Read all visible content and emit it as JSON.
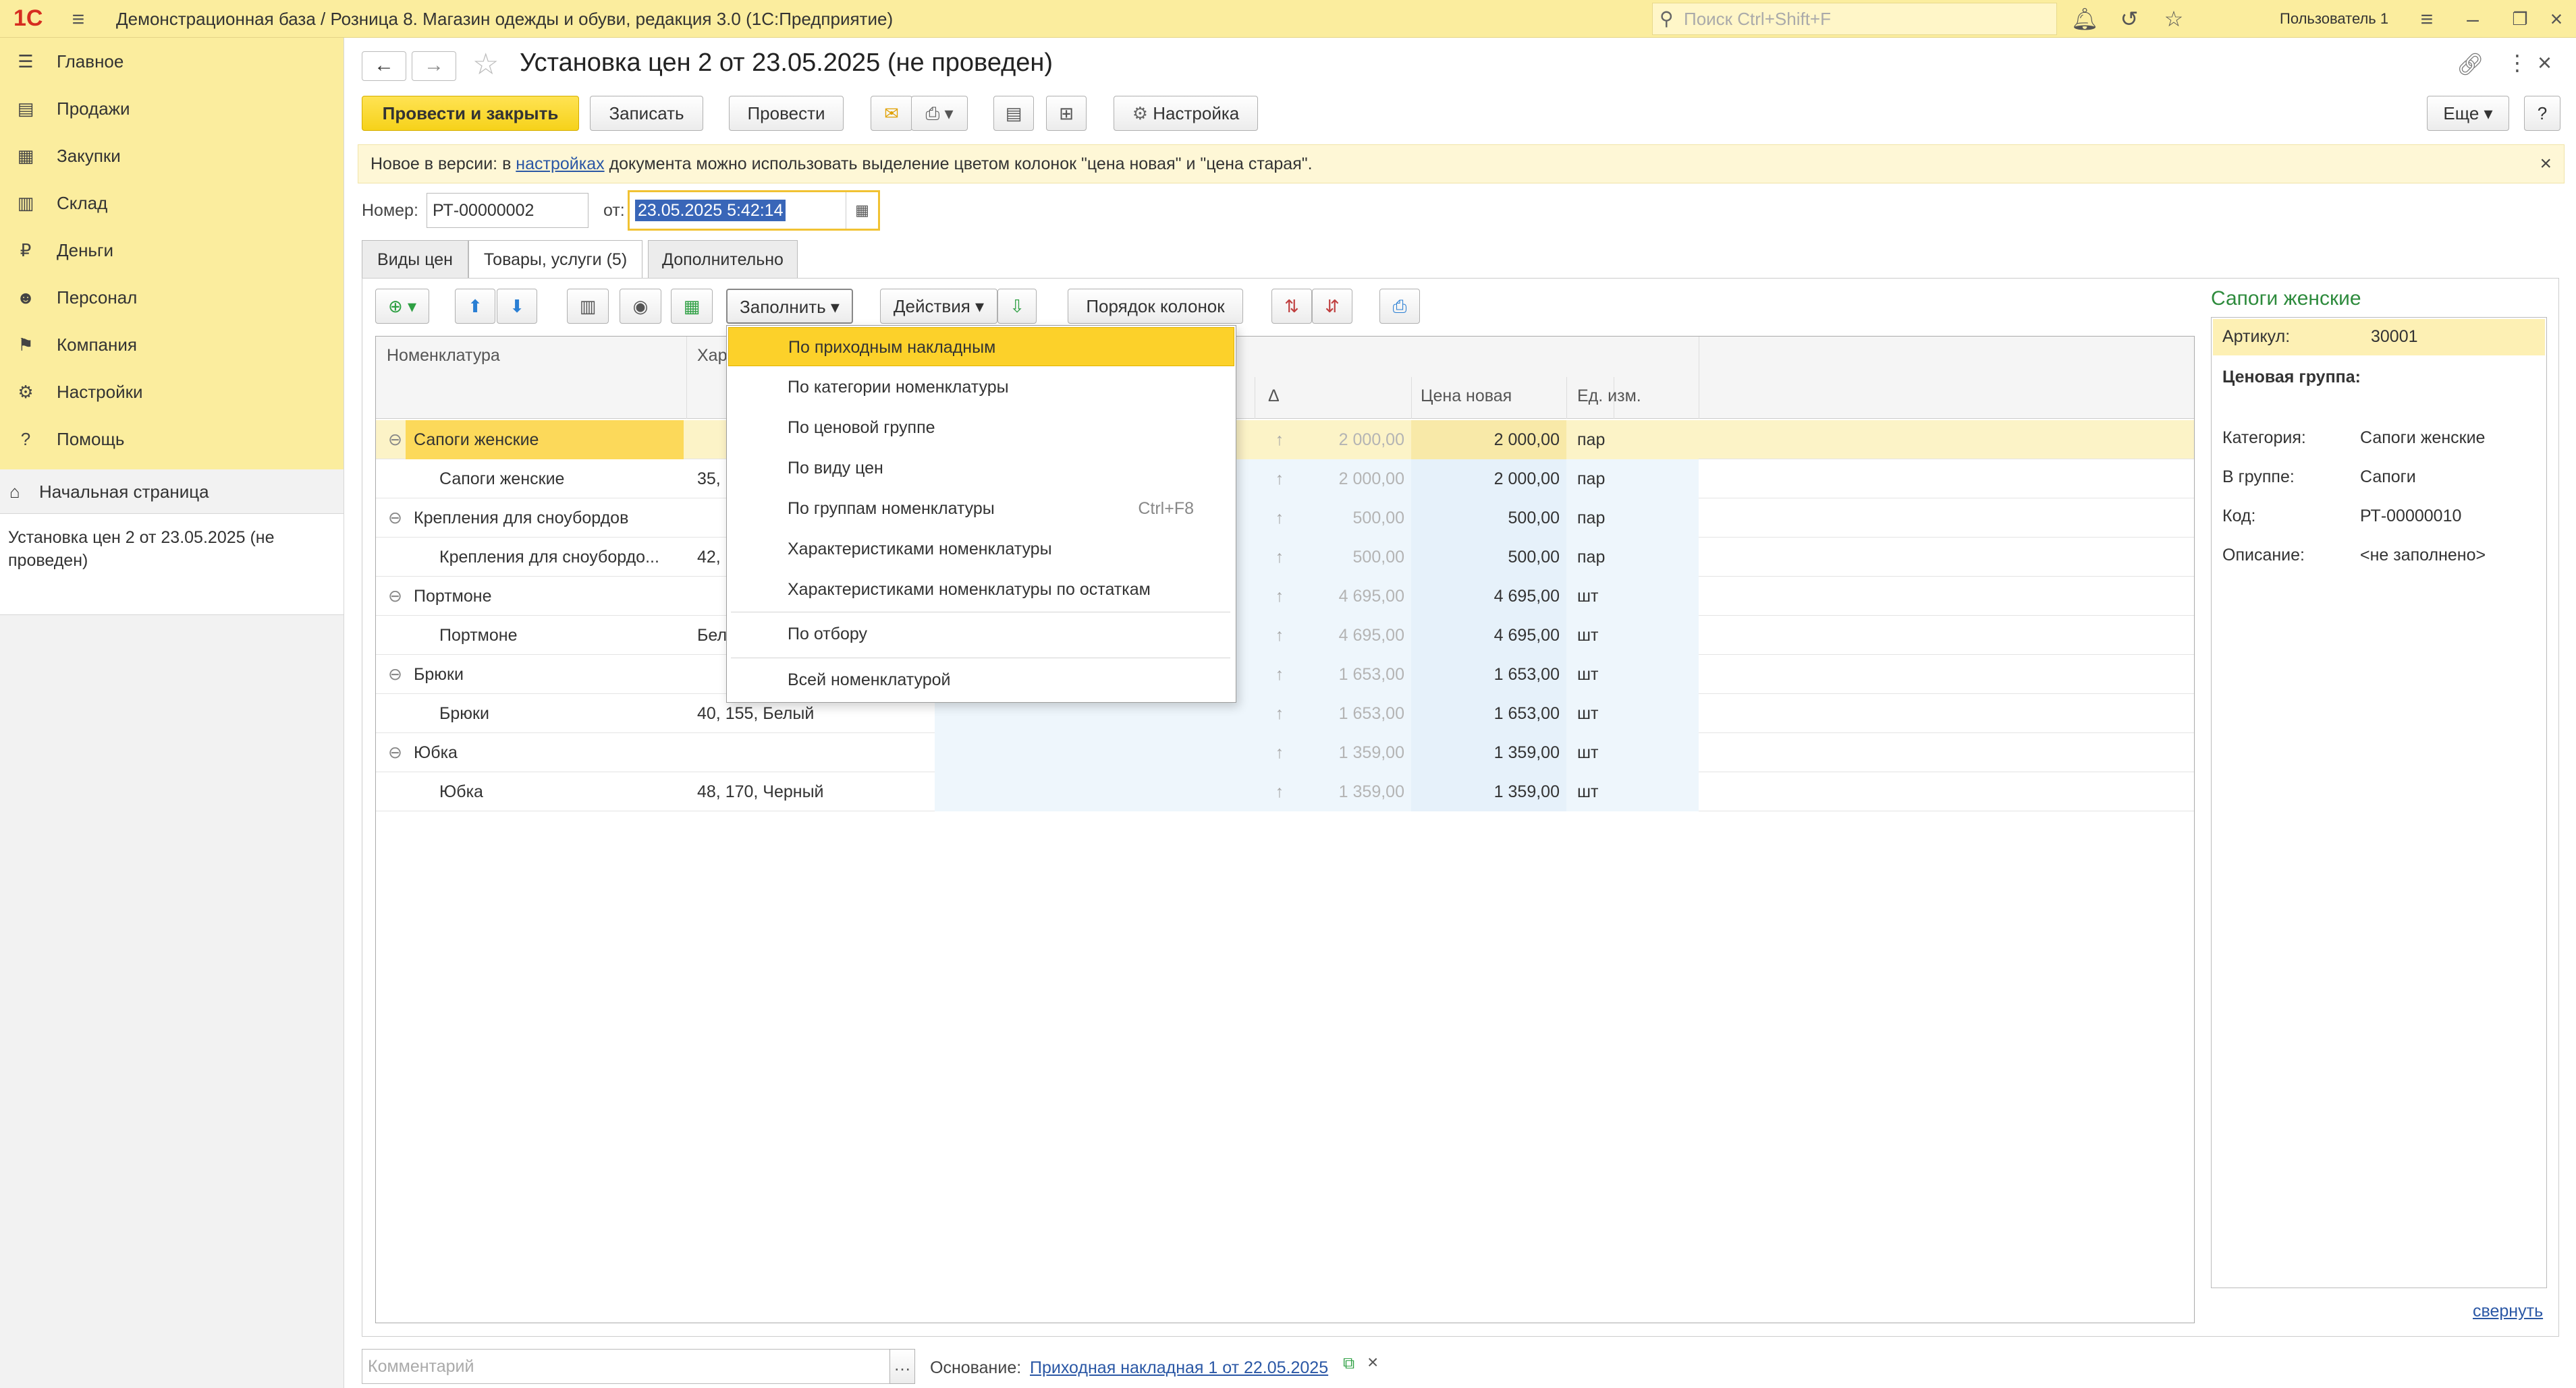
{
  "titlebar": {
    "logo": "1С",
    "title": "Демонстрационная база / Розница 8. Магазин одежды и обуви, редакция 3.0  (1С:Предприятие)",
    "search_placeholder": "Поиск Ctrl+Shift+F",
    "user": "Пользователь 1"
  },
  "sidebar": {
    "items": [
      {
        "label": "Главное",
        "icon": "menu-lines-icon"
      },
      {
        "label": "Продажи",
        "icon": "cash-register-icon"
      },
      {
        "label": "Закупки",
        "icon": "cart-icon"
      },
      {
        "label": "Склад",
        "icon": "warehouse-icon"
      },
      {
        "label": "Деньги",
        "icon": "ruble-icon"
      },
      {
        "label": "Персонал",
        "icon": "people-icon"
      },
      {
        "label": "Компания",
        "icon": "flag-icon"
      },
      {
        "label": "Настройки",
        "icon": "gear-icon"
      },
      {
        "label": "Помощь",
        "icon": "help-icon"
      }
    ],
    "home": "Начальная страница",
    "open_window": "Установка цен 2 от 23.05.2025 (не проведен)"
  },
  "form": {
    "title": "Установка цен 2 от 23.05.2025 (не проведен)",
    "buttons": {
      "post_close": "Провести и закрыть",
      "save": "Записать",
      "post": "Провести",
      "settings": "Настройка",
      "more": "Еще",
      "help": "?"
    },
    "info": {
      "prefix": "Новое в версии: в ",
      "link": "настройках",
      "suffix": " документа можно использовать выделение цветом колонок \"цена новая\" и \"цена старая\"."
    },
    "number_label": "Номер:",
    "number_value": "РТ-00000002",
    "date_label": "от:",
    "date_value": "23.05.2025  5:42:14",
    "tabs": [
      "Виды цен",
      "Товары, услуги (5)",
      "Дополнительно"
    ],
    "toolbar": {
      "fill": "Заполнить",
      "actions": "Действия",
      "column_order": "Порядок колонок"
    },
    "comment_placeholder": "Комментарий",
    "basis_label": "Основание:",
    "basis_link": "Приходная накладная 1 от 22.05.2025",
    "collapse": "свернуть"
  },
  "table": {
    "headers": {
      "nomenclature": "Номенклатура",
      "char_partial": "Хар",
      "old_partial": "я",
      "delta": "Δ",
      "new_price": "Цена новая",
      "unit": "Ед. изм."
    },
    "rows": [
      {
        "group": true,
        "name": "Сапоги женские",
        "char": "",
        "old": "2 000,00",
        "new": "2 000,00",
        "unit": "пар"
      },
      {
        "group": false,
        "name": "Сапоги женские",
        "char": "35,",
        "old": "2 000,00",
        "new": "2 000,00",
        "unit": "пар"
      },
      {
        "group": true,
        "name": "Крепления для сноубордов",
        "char": "",
        "old": "500,00",
        "new": "500,00",
        "unit": "пар"
      },
      {
        "group": false,
        "name": "Крепления для сноубордо...",
        "char": "42,",
        "old": "500,00",
        "new": "500,00",
        "unit": "пар"
      },
      {
        "group": true,
        "name": "Портмоне",
        "char": "",
        "old": "4 695,00",
        "new": "4 695,00",
        "unit": "шт"
      },
      {
        "group": false,
        "name": "Портмоне",
        "char": "Бел",
        "old": "4 695,00",
        "new": "4 695,00",
        "unit": "шт"
      },
      {
        "group": true,
        "name": "Брюки",
        "char": "",
        "old": "1 653,00",
        "new": "1 653,00",
        "unit": "шт"
      },
      {
        "group": false,
        "name": "Брюки",
        "char": "40, 155, Белый",
        "old": "1 653,00",
        "new": "1 653,00",
        "unit": "шт"
      },
      {
        "group": true,
        "name": "Юбка",
        "char": "",
        "old": "1 359,00",
        "new": "1 359,00",
        "unit": "шт"
      },
      {
        "group": false,
        "name": "Юбка",
        "char": "48, 170, Черный",
        "old": "1 359,00",
        "new": "1 359,00",
        "unit": "шт"
      }
    ]
  },
  "fill_menu": {
    "items": [
      {
        "label": "По приходным накладным",
        "shortcut": ""
      },
      {
        "label": "По категории номенклатуры",
        "shortcut": ""
      },
      {
        "label": "По ценовой группе",
        "shortcut": ""
      },
      {
        "label": "По виду цен",
        "shortcut": ""
      },
      {
        "label": "По группам номенклатуры",
        "shortcut": "Ctrl+F8"
      },
      {
        "label": "Характеристиками номенклатуры",
        "shortcut": ""
      },
      {
        "label": "Характеристиками номенклатуры по остаткам",
        "shortcut": ""
      },
      {
        "label": "По отбору",
        "shortcut": ""
      },
      {
        "label": "Всей номенклатурой",
        "shortcut": ""
      }
    ]
  },
  "detail": {
    "title": "Сапоги женские",
    "article_label": "Артикул:",
    "article_value": "30001",
    "price_group_label": "Ценовая группа:",
    "category_label": "Категория:",
    "category_value": "Сапоги женские",
    "in_group_label": "В группе:",
    "in_group_value": "Сапоги",
    "code_label": "Код:",
    "code_value": "РТ-00000010",
    "description_label": "Описание:",
    "description_value": "<не заполнено>"
  },
  "colors": {
    "accent_yellow": "#fbed9e",
    "primary_button": "#f6d21a",
    "menu_highlight": "#fcd12a",
    "link": "#2a57a5",
    "detail_title": "#2e8b3d"
  }
}
